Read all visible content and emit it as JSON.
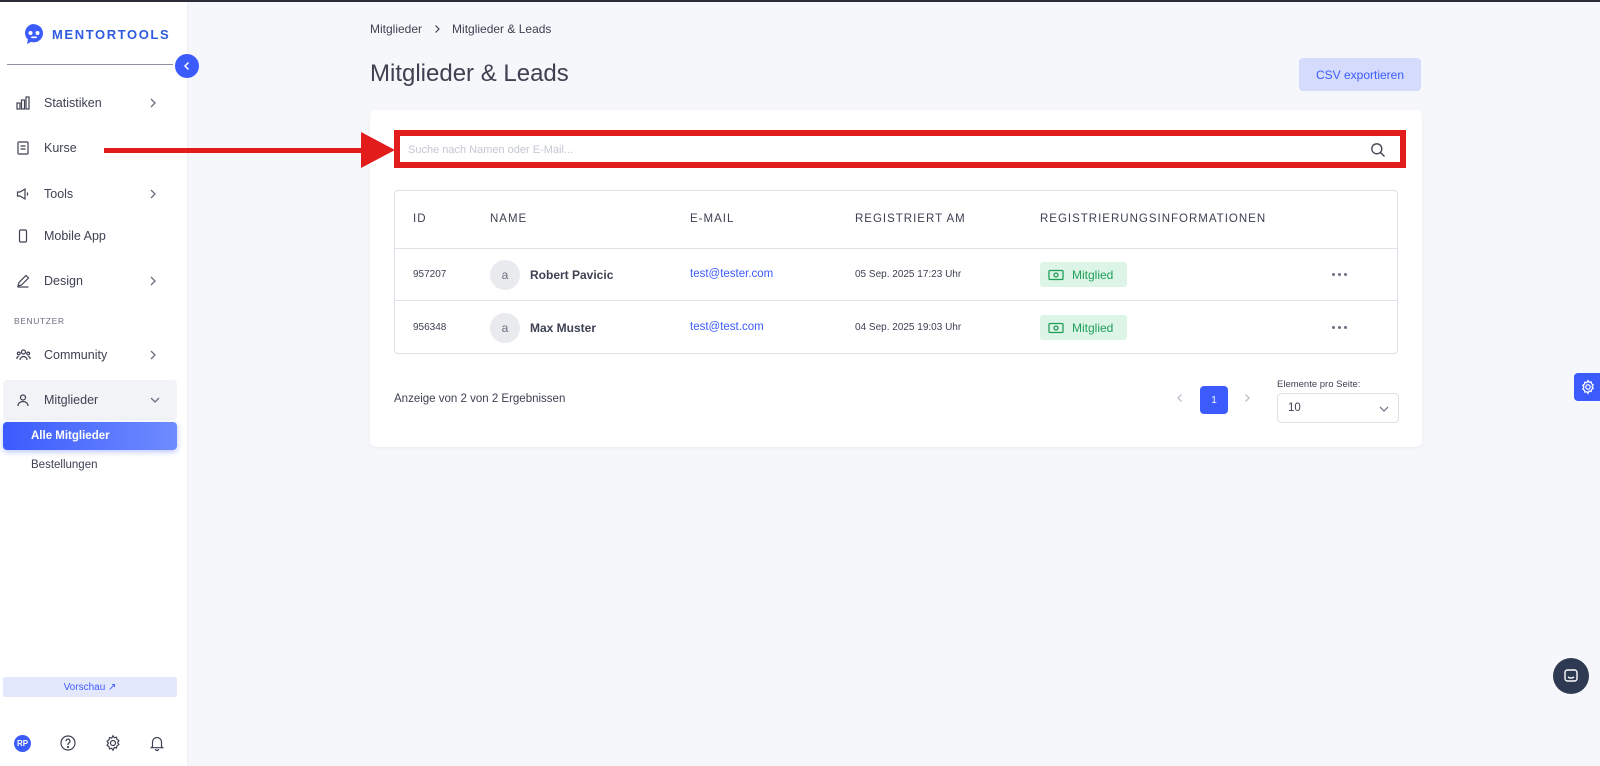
{
  "app": {
    "logo_text": "MENTORTOOLS",
    "accent_color": "#3b5bfd",
    "annotation_color": "#e21b1b"
  },
  "sidebar": {
    "items": [
      {
        "label": "Statistiken",
        "icon": "bar-chart-icon"
      },
      {
        "label": "Kurse",
        "icon": "book-icon"
      },
      {
        "label": "Tools",
        "icon": "megaphone-icon"
      },
      {
        "label": "Mobile App",
        "icon": "phone-icon"
      },
      {
        "label": "Design",
        "icon": "pencil-icon"
      }
    ],
    "section_label": "BENUTZER",
    "user_items": [
      {
        "label": "Community",
        "icon": "community-icon"
      },
      {
        "label": "Mitglieder",
        "icon": "user-icon"
      }
    ],
    "sub_items": [
      "Alle Mitglieder",
      "Bestellungen"
    ],
    "preview_label": "Vorschau ↗",
    "footer": {
      "avatar_initials": "RP",
      "icons": [
        "help-icon",
        "gear-icon",
        "bell-icon"
      ]
    }
  },
  "breadcrumb": [
    "Mitglieder",
    "Mitglieder & Leads"
  ],
  "page_title": "Mitglieder & Leads",
  "csv_button": "CSV exportieren",
  "search": {
    "placeholder": "Suche nach Namen oder E-Mail...",
    "value": ""
  },
  "table": {
    "headers": [
      "ID",
      "NAME",
      "E-MAIL",
      "REGISTRIERT AM",
      "REGISTRIERUNGSINFORMATIONEN"
    ],
    "rows": [
      {
        "id": "957207",
        "avatar": "a",
        "name": "Robert Pavicic",
        "email": "test@tester.com",
        "registered": "05 Sep. 2025 17:23 Uhr",
        "status": "Mitglied"
      },
      {
        "id": "956348",
        "avatar": "a",
        "name": "Max Muster",
        "email": "test@test.com",
        "registered": "04 Sep. 2025 19:03 Uhr",
        "status": "Mitglied"
      }
    ]
  },
  "pagination": {
    "summary": "Anzeige von 2 von 2 Ergebnissen",
    "current_page": "1",
    "per_page_label": "Elemente pro Seite:",
    "per_page_value": "10"
  }
}
